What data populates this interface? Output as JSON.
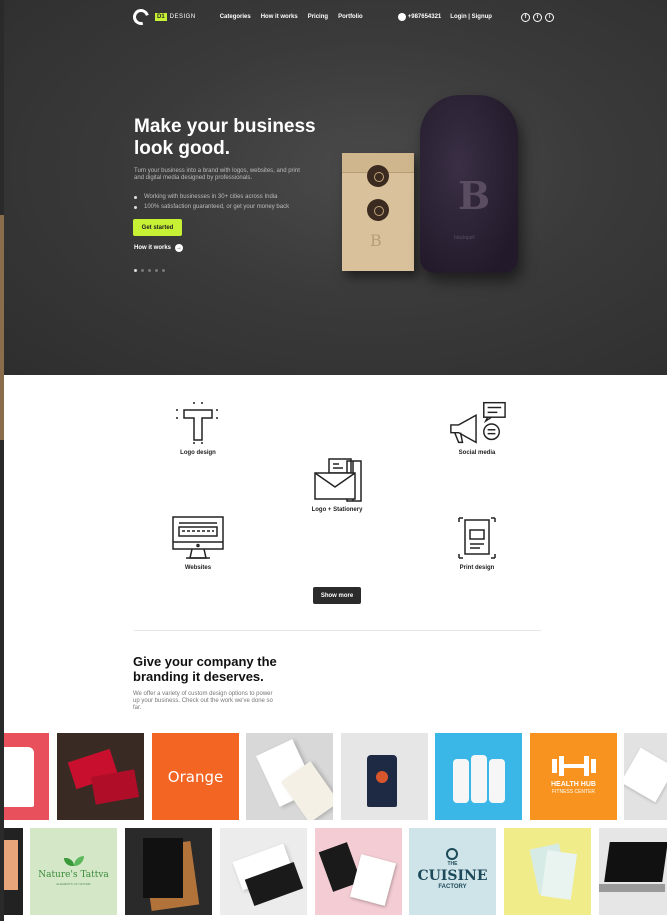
{
  "brand": {
    "badge": "D1",
    "name": "DESIGN"
  },
  "nav": {
    "links": [
      "Categories",
      "How it works",
      "Pricing",
      "Portfolio"
    ],
    "phone": "+987654321",
    "auth": "Login | Signup",
    "social": [
      "f",
      "t",
      "i"
    ]
  },
  "hero": {
    "title": "Make your business look good.",
    "subtitle": "Turn your business into a brand with logos, websites, and print and digital media designed by professionals.",
    "bullets": [
      "Working with businesses in 30+ cities across India",
      "100% satisfaction guaranteed, or get your money back"
    ],
    "cta": "Get started",
    "how_link": "How it works",
    "slides": 5,
    "active_slide": 1,
    "bag_word": "blackquill"
  },
  "services": {
    "logo": "Logo design",
    "social": "Social media",
    "stationery": "Logo + Stationery",
    "websites": "Websites",
    "print": "Print design",
    "show_more": "Show more"
  },
  "branding": {
    "title": "Give your company the branding it deserves.",
    "subtitle": "We offer a variety of custom design options to power up your business. Check out the work we've done so far."
  },
  "portfolio": {
    "orange": "Orange",
    "health_title": "HEALTH HUB",
    "health_sub": "FITNESS CENTER",
    "natures": "Nature's Tattva",
    "natures_sub": "ELEMENTS OF NATURE",
    "cuisine_the": "THE",
    "cuisine": "CUISINE",
    "cuisine_sub": "FACTORY"
  },
  "colors": {
    "accent": "#c6f135",
    "hero_bg": "#3a3a3a",
    "orange": "#f26522"
  }
}
